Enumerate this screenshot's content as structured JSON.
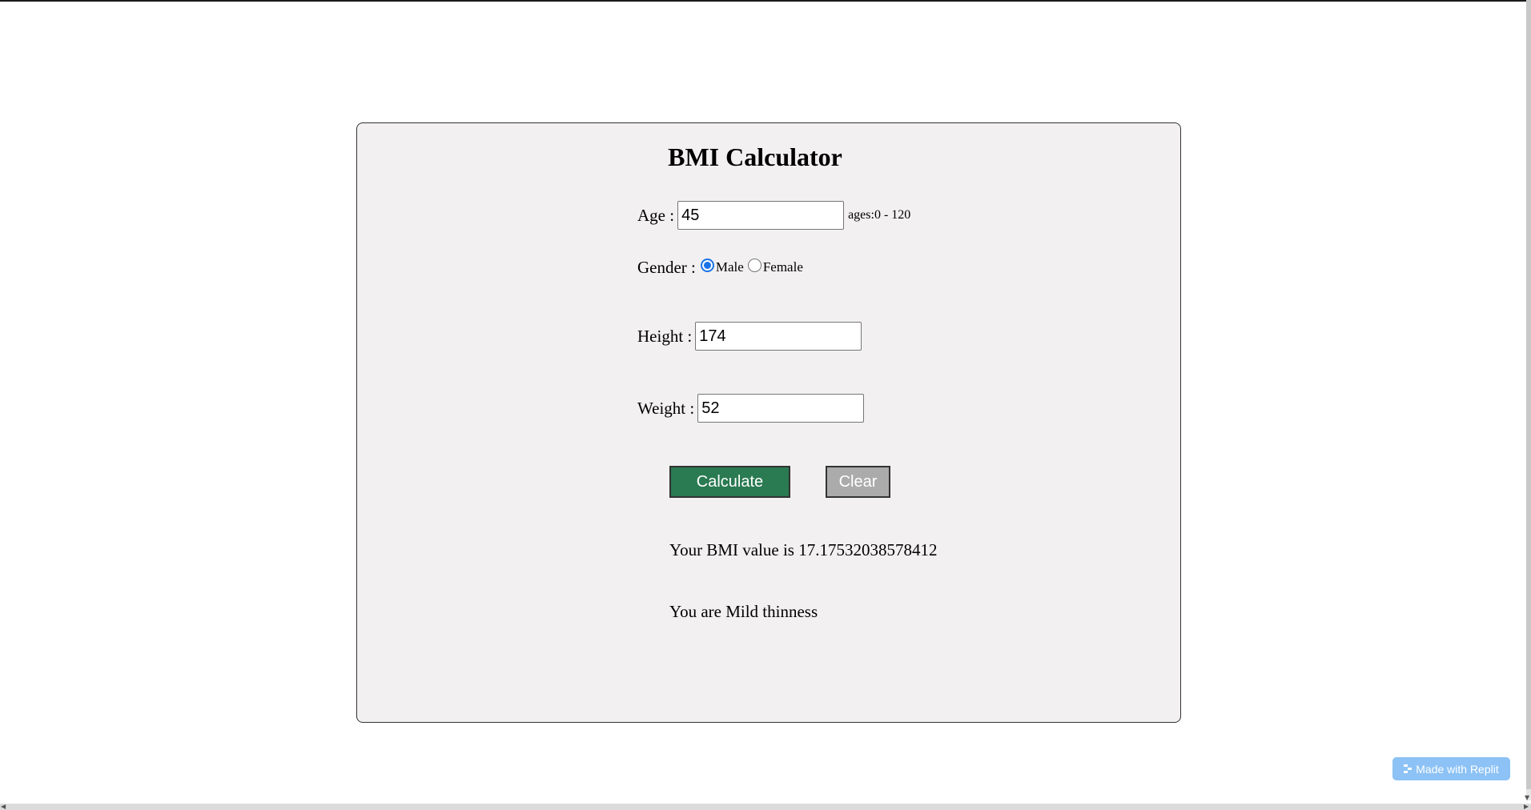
{
  "title": "BMI Calculator",
  "form": {
    "age_label": "Age :",
    "age_value": "45",
    "age_hint": "ages:0 - 120",
    "gender_label": "Gender :",
    "gender_options": [
      "Male",
      "Female"
    ],
    "gender_selected": "Male",
    "height_label": "Height :",
    "height_value": "174",
    "weight_label": "Weight :",
    "weight_value": "52"
  },
  "buttons": {
    "calculate_label": "Calculate",
    "clear_label": "Clear"
  },
  "result": {
    "bmi_text": "Your BMI value is 17.17532038578412",
    "category_text": "You are Mild thinness"
  },
  "badge": {
    "label": "Made with Replit"
  },
  "colors": {
    "calculate_button": "#2a7a52",
    "clear_button": "#ababab",
    "panel_background": "#f2f0f0",
    "radio_accent": "#1a73e8",
    "badge_background": "#8cc2f5"
  }
}
